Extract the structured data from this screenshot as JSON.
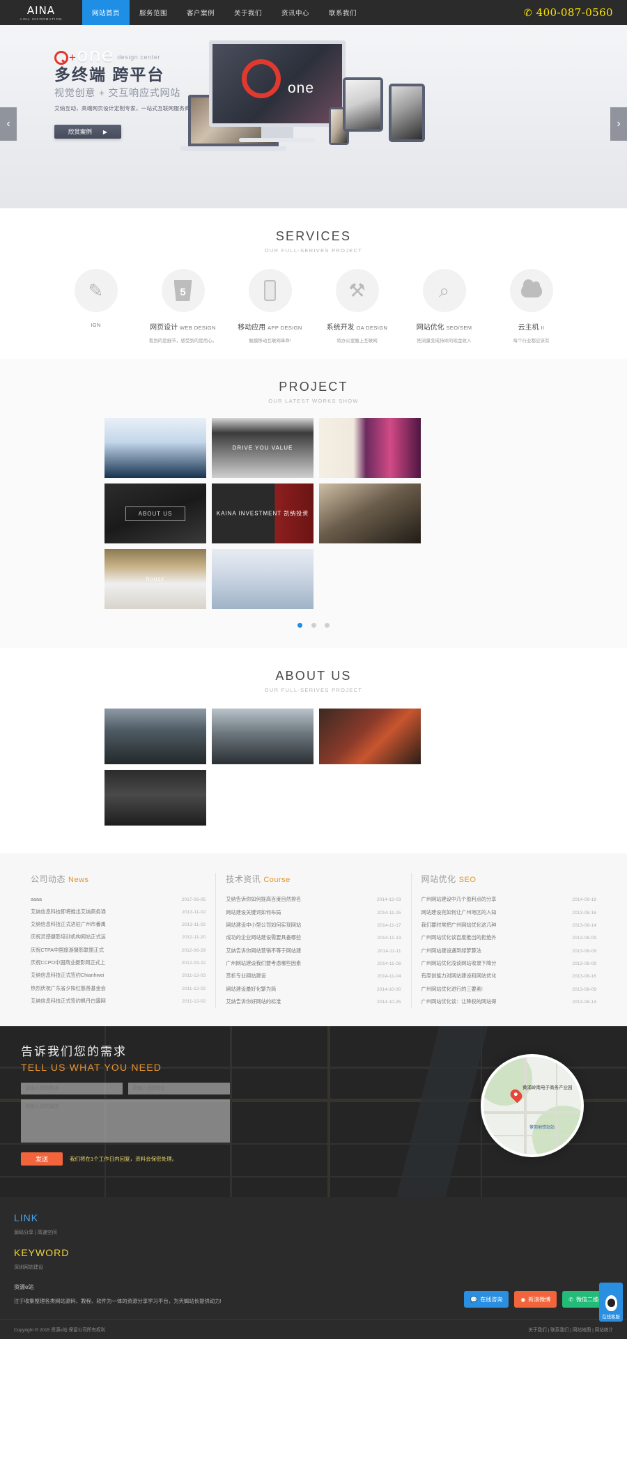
{
  "header": {
    "logo_mark": "AINA",
    "logo_sub": "AINA INFORMATION",
    "nav": [
      {
        "label": "网站首页",
        "active": true
      },
      {
        "label": "服务范围",
        "active": false
      },
      {
        "label": "客户案例",
        "active": false
      },
      {
        "label": "关于我们",
        "active": false
      },
      {
        "label": "资讯中心",
        "active": false
      },
      {
        "label": "联系我们",
        "active": false
      }
    ],
    "phone_icon": "phone-icon",
    "phone": "400-087-0560",
    "accent_blue": "#1f8fe5",
    "phone_yellow": "#ffe600"
  },
  "hero": {
    "brand_o": "O",
    "brand_plus": "+",
    "brand_one": "one",
    "brand_tag": "design center",
    "headline": "多终端 跨平台",
    "subhead": "视觉创意 + 交互响应式网站",
    "desc": "艾纳互动，高端网页设计定制专家，一站式互联网服务商",
    "button": "欣赏案例",
    "button_arrow": "▶",
    "arrow_left": "‹",
    "arrow_right": "›",
    "monitor_text": "one"
  },
  "services": {
    "title": "SERVICES",
    "subtitle": "OUR FULL-SERIVES PROJECT",
    "items": [
      {
        "icon": "pen-icon",
        "name": "",
        "en": "IGN",
        "desc": ""
      },
      {
        "icon": "html5-icon",
        "name": "网页设计",
        "en": "WEB DESIGN",
        "desc": "看到的是细节，感受到的是用心。"
      },
      {
        "icon": "mobile-icon",
        "name": "移动应用",
        "en": "APP DESIGN",
        "desc": "触摸移动互联网革命!"
      },
      {
        "icon": "tools-icon",
        "name": "系统开发",
        "en": "OA DESIGN",
        "desc": "将办公室搬上互联网"
      },
      {
        "icon": "magnifier-icon",
        "name": "网站优化",
        "en": "SEO/SEM",
        "desc": "把流量变成持续的现金收入"
      },
      {
        "icon": "cloud-icon",
        "name": "云主机",
        "en": "II",
        "desc": "每个行业都应该有"
      }
    ]
  },
  "project": {
    "title": "PROJECT",
    "subtitle": "OUR LATEST WORKS SHOW",
    "items": [
      {
        "name": "project-thumb-corporate",
        "label": ""
      },
      {
        "name": "project-thumb-drive",
        "label": "DRIVE YOU VALUE"
      },
      {
        "name": "project-thumb-beauty",
        "label": ""
      },
      {
        "name": "project-thumb-aboutus",
        "label": "ABOUT US"
      },
      {
        "name": "project-thumb-kaina",
        "label": "KAINA INVESTMENT 凯纳投资"
      },
      {
        "name": "project-thumb-stilllife",
        "label": ""
      },
      {
        "name": "project-thumb-houzz",
        "label": "houzz"
      },
      {
        "name": "project-thumb-responsive",
        "label": ""
      }
    ],
    "dots": [
      "1",
      "2",
      "3"
    ],
    "active_dot": 0
  },
  "about": {
    "title": "ABOUT US",
    "subtitle": "OUR FULL-SERIVES PROJECT",
    "items": [
      {
        "name": "about-photo-boardroom"
      },
      {
        "name": "about-photo-office"
      },
      {
        "name": "about-photo-lounge"
      },
      {
        "name": "about-photo-seminar"
      }
    ]
  },
  "news": {
    "columns": [
      {
        "title_cn": "公司动态",
        "title_en": "News",
        "items": [
          {
            "text": "aaaa",
            "date": "2017-06-05"
          },
          {
            "text": "艾纳信息科技即将推出艾纳商务通",
            "date": "2013-11-02"
          },
          {
            "text": "艾纳信息科技正式进驻广州市番禺",
            "date": "2013-11-02"
          },
          {
            "text": "庆祝灵感摄影培训机构网站正式运",
            "date": "2012-11-20"
          },
          {
            "text": "庆祝CTPA中国旅游摄影联盟正式",
            "date": "2012-06-29"
          },
          {
            "text": "庆祝CCPO中国商业摄影网正式上",
            "date": "2012-03-22"
          },
          {
            "text": "艾纳信息科技正式签约Chianhwei",
            "date": "2011-12-03"
          },
          {
            "text": "热烈庆祝广东省夕阳红慈善基金会",
            "date": "2011-12-02"
          },
          {
            "text": "艾纳信息科技正式签约枫丹白露网",
            "date": "2011-12-02"
          }
        ]
      },
      {
        "title_cn": "技术资讯",
        "title_en": "Course",
        "items": [
          {
            "text": "艾纳告诉你如何提高百度自然排名",
            "date": "2014-12-03"
          },
          {
            "text": "网站建设关键词如何布局",
            "date": "2014-11-25"
          },
          {
            "text": "网站建设中小型公司如何实现网站",
            "date": "2014-11-17"
          },
          {
            "text": "成功的企业网站建设需要具备哪些",
            "date": "2014-11-13"
          },
          {
            "text": "艾纳告诉你网站营销不等于网站建",
            "date": "2014-11-11"
          },
          {
            "text": "广州网站建设我们要考虑哪些因素",
            "date": "2014-11-06"
          },
          {
            "text": "赏析专业网站建设",
            "date": "2014-11-04"
          },
          {
            "text": "网站建设最好化繁为简",
            "date": "2014-10-30"
          },
          {
            "text": "艾纳告诉你好网站的标准",
            "date": "2014-10-25"
          }
        ]
      },
      {
        "title_cn": "网站优化",
        "title_en": "SEO",
        "items": [
          {
            "text": "广州网站建设中几个盈利点的分享",
            "date": "2014-09-18"
          },
          {
            "text": "网站建设完如何让广州地区的人知",
            "date": "2013-08-16"
          },
          {
            "text": "我们要时常把广州网站优化这几种",
            "date": "2013-08-14"
          },
          {
            "text": "广州网站优化谈百度推出的拒绝外",
            "date": "2013-08-09"
          },
          {
            "text": "广州网站建设遇到绿萝算法",
            "date": "2013-08-09"
          },
          {
            "text": "广州网站优化浅谈网站收录下降分",
            "date": "2013-08-09"
          },
          {
            "text": "有原创能力对网站建设和网站优化",
            "date": "2013-08-16"
          },
          {
            "text": "广州网站优化进行的三要素!",
            "date": "2013-08-09"
          },
          {
            "text": "广州网站优化谈：让降权的网站得",
            "date": "2013-08-14"
          }
        ]
      }
    ]
  },
  "contact": {
    "heading_cn": "告诉我们您的需求",
    "heading_en": "TELL US WHAT YOU NEED",
    "name_placeholder": "请输入您的姓名",
    "qq_placeholder": "请输入您的QQ",
    "message_placeholder": "请输入您的留言",
    "send_label": "发送",
    "note": "我们将在1个工作日内回复，资料会保密处理。",
    "send_color": "#f2643c",
    "map_pin_label": "黄浦岭南电子商务产业园",
    "map_station_label": "萝岗地铁站站"
  },
  "footer": {
    "link_title": "LINK",
    "link_items": "源码分享 | 高速空间",
    "keyword_title": "KEYWORD",
    "keyword_items": "深圳网站建设",
    "site_name": "资源e站",
    "site_desc": "注于收集整理各类网站源码、教程、软件为一体的资源分享学习平台，为天蝎站长提供动力!",
    "chat_buttons": [
      {
        "icon": "chat-bubble-icon",
        "label": "在线咨询",
        "color": "#2a8fe0"
      },
      {
        "icon": "weibo-icon",
        "label": "新浪微博",
        "color": "#f2643c"
      },
      {
        "icon": "wechat-icon",
        "label": "微信二维码",
        "color": "#22bb77"
      }
    ],
    "qq_side_label": "在线客服",
    "copyright": "Copyright ® 2015 资源e站 保留公司所有权利",
    "bottom_links": [
      "关于我们",
      "联系我们",
      "网站地图",
      "网站统计"
    ],
    "link_blue": "#4aa3e8",
    "keyword_yellow": "#f2d33c"
  }
}
